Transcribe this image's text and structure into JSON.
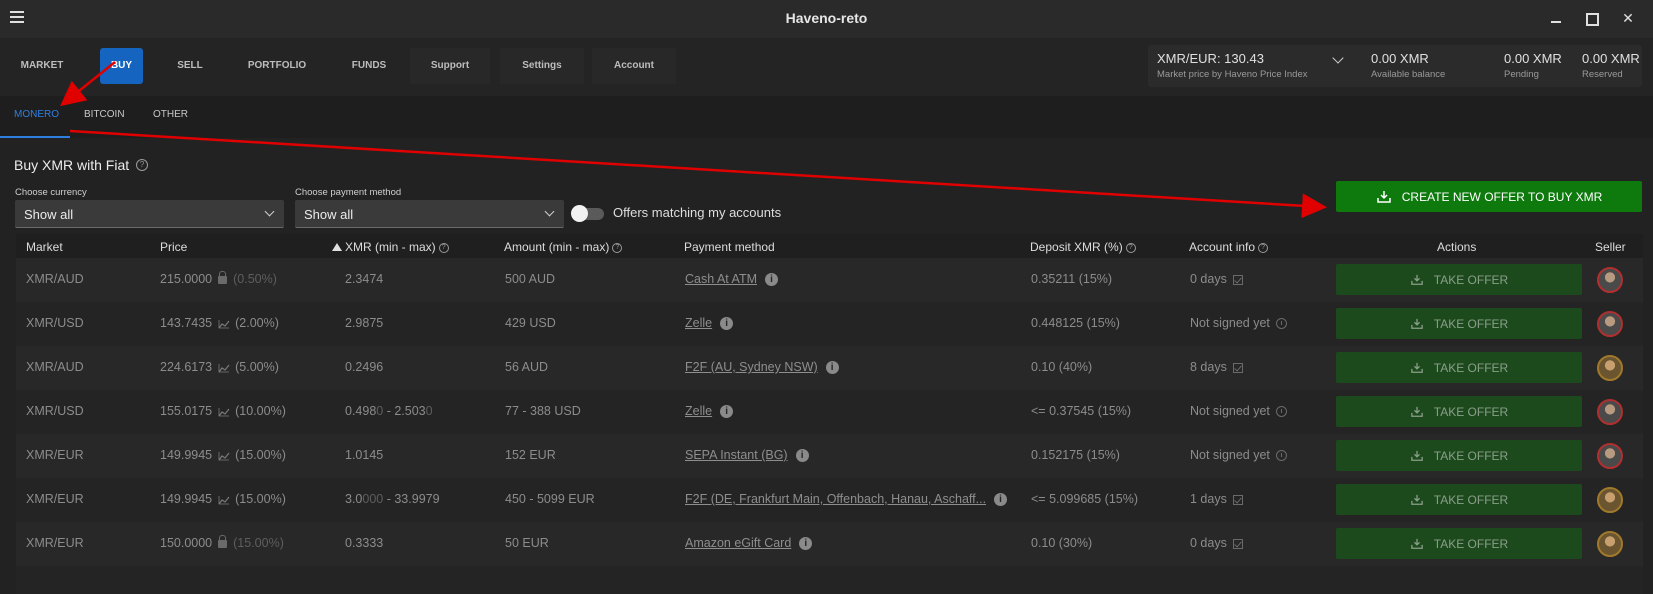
{
  "window": {
    "title": "Haveno-reto"
  },
  "nav": {
    "items": [
      "MARKET",
      "BUY",
      "SELL",
      "PORTFOLIO",
      "FUNDS",
      "Support",
      "Settings",
      "Account"
    ],
    "active": "BUY"
  },
  "market_price": {
    "value": "XMR/EUR: 130.43",
    "source": "Market price by Haveno Price Index"
  },
  "balances": [
    {
      "value": "0.00 XMR",
      "label": "Available balance"
    },
    {
      "value": "0.00 XMR",
      "label": "Pending"
    },
    {
      "value": "0.00 XMR",
      "label": "Reserved"
    }
  ],
  "subtabs": {
    "items": [
      "MONERO",
      "BITCOIN",
      "OTHER"
    ],
    "active": "MONERO"
  },
  "section": {
    "title": "Buy XMR with Fiat",
    "currency_label": "Choose currency",
    "currency_value": "Show all",
    "payment_label": "Choose payment method",
    "payment_value": "Show all",
    "toggle_label": "Offers matching my accounts",
    "toggle_on": false,
    "create_button": "CREATE NEW OFFER TO BUY XMR"
  },
  "table": {
    "columns": [
      "Market",
      "Price",
      "XMR (min - max)",
      "Amount (min - max)",
      "Payment method",
      "Deposit XMR (%)",
      "Account info",
      "Actions",
      "Seller"
    ],
    "action_label": "TAKE OFFER",
    "rows": [
      {
        "market": "XMR/AUD",
        "price": "215.0000",
        "pct": "(0.50%)",
        "price_icon": "lock",
        "xmr": "2.3474",
        "xmr_dim": "",
        "xmr_max": "",
        "xmr_max_dim": "",
        "amount": "500 AUD",
        "payment": "Cash At ATM",
        "deposit": "0.35211 (15%)",
        "account": "0 days",
        "account_icon": "check",
        "avatar": "red"
      },
      {
        "market": "XMR/USD",
        "price": "143.7435",
        "pct": "(2.00%)",
        "price_icon": "trend",
        "xmr": "2.9875",
        "xmr_dim": "",
        "xmr_max": "",
        "xmr_max_dim": "",
        "amount": "429 USD",
        "payment": "Zelle",
        "deposit": "0.448125 (15%)",
        "account": "Not signed yet",
        "account_icon": "clock",
        "avatar": "red"
      },
      {
        "market": "XMR/AUD",
        "price": "224.6173",
        "pct": "(5.00%)",
        "price_icon": "trend",
        "xmr": "0.2496",
        "xmr_dim": "",
        "xmr_max": "",
        "xmr_max_dim": "",
        "amount": "56 AUD",
        "payment": "F2F (AU, Sydney NSW)",
        "deposit": "0.10 (40%)",
        "account": "8 days",
        "account_icon": "check",
        "avatar": "gold"
      },
      {
        "market": "XMR/USD",
        "price": "155.0175",
        "pct": "(10.00%)",
        "price_icon": "trend",
        "xmr": "0.498",
        "xmr_dim": "0",
        "xmr_max": "2.503",
        "xmr_max_dim": "0",
        "amount": "77 - 388 USD",
        "payment": "Zelle",
        "deposit": "<= 0.37545 (15%)",
        "account": "Not signed yet",
        "account_icon": "clock",
        "avatar": "red"
      },
      {
        "market": "XMR/EUR",
        "price": "149.9945",
        "pct": "(15.00%)",
        "price_icon": "trend",
        "xmr": "1.0145",
        "xmr_dim": "",
        "xmr_max": "",
        "xmr_max_dim": "",
        "amount": "152 EUR",
        "payment": "SEPA Instant (BG)",
        "deposit": "0.152175 (15%)",
        "account": "Not signed yet",
        "account_icon": "clock",
        "avatar": "red"
      },
      {
        "market": "XMR/EUR",
        "price": "149.9945",
        "pct": "(15.00%)",
        "price_icon": "trend",
        "xmr": "3.0",
        "xmr_dim": "000",
        "xmr_max": "33.9979",
        "xmr_max_dim": "",
        "amount": "450 - 5099 EUR",
        "payment": "F2F (DE, Frankfurt Main, Offenbach, Hanau, Aschaff...",
        "deposit": "<= 5.099685 (15%)",
        "account": "1 days",
        "account_icon": "check",
        "avatar": "gold"
      },
      {
        "market": "XMR/EUR",
        "price": "150.0000",
        "pct": "(15.00%)",
        "price_icon": "lock",
        "xmr": "0.3333",
        "xmr_dim": "",
        "xmr_max": "",
        "xmr_max_dim": "",
        "amount": "50 EUR",
        "payment": "Amazon eGift Card",
        "deposit": "0.10 (30%)",
        "account": "0 days",
        "account_icon": "check",
        "avatar": "gold"
      }
    ]
  },
  "colors": {
    "accent_blue": "#1565c0",
    "create_green": "#0e7a0e",
    "take_green": "#1d4a1d",
    "annotation_red": "#e00000"
  }
}
